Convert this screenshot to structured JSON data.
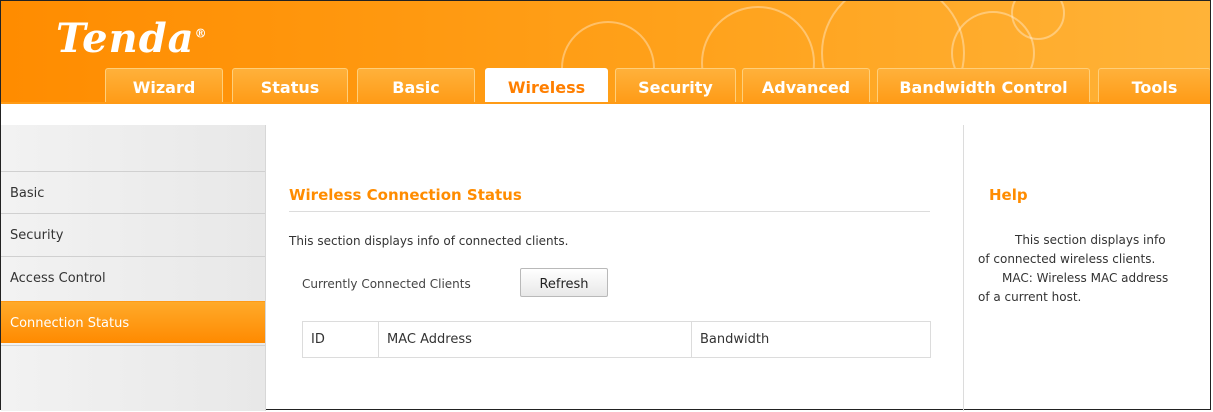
{
  "brand": {
    "logo": "Tenda"
  },
  "nav": {
    "tabs": [
      {
        "label": "Wizard"
      },
      {
        "label": "Status"
      },
      {
        "label": "Basic"
      },
      {
        "label": "Wireless"
      },
      {
        "label": "Security"
      },
      {
        "label": "Advanced"
      },
      {
        "label": "Bandwidth Control"
      },
      {
        "label": "Tools"
      }
    ],
    "active_tab": "Wireless"
  },
  "sidebar": {
    "items": [
      {
        "label": "Basic"
      },
      {
        "label": "Security"
      },
      {
        "label": "Access Control"
      },
      {
        "label": "Connection Status"
      }
    ],
    "active_item": "Connection Status"
  },
  "main": {
    "title": "Wireless Connection Status",
    "description": "This section displays info of connected clients.",
    "clients_label": "Currently Connected Clients",
    "refresh_label": "Refresh",
    "table": {
      "columns": [
        "ID",
        "MAC Address",
        "Bandwidth"
      ],
      "rows": []
    }
  },
  "help": {
    "title": "Help",
    "paragraphs": [
      "This section displays info of connected wireless clients.",
      "MAC: Wireless MAC address of a current host."
    ]
  },
  "colors": {
    "accent": "#ff8c00",
    "banner": "#ffa11a"
  }
}
